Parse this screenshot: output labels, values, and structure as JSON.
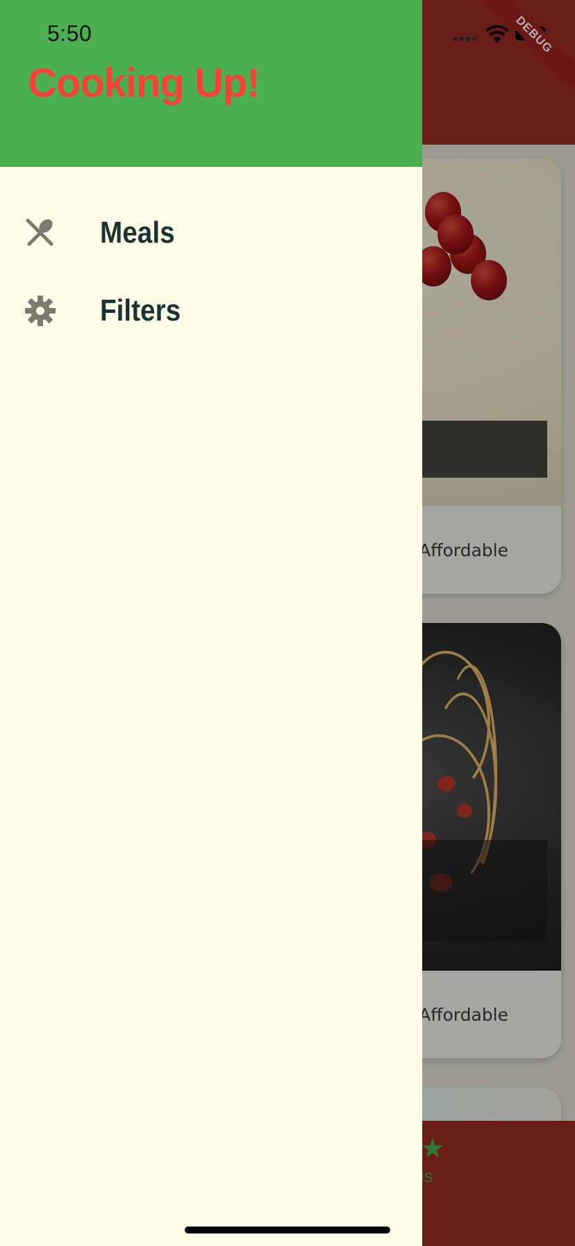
{
  "status_bar": {
    "time": "5:50"
  },
  "drawer": {
    "title": "Cooking Up!",
    "items": [
      {
        "label": "Meals",
        "icon": "restaurant-icon"
      },
      {
        "label": "Filters",
        "icon": "gear-icon"
      }
    ]
  },
  "background": {
    "cards": [
      {
        "meta": "Affordable"
      },
      {
        "meta": "Affordable"
      }
    ],
    "bottom_nav": {
      "partial_label": "orites"
    },
    "debug_banner": "DEBUG"
  },
  "colors": {
    "drawer_header": "#4caf50",
    "title": "#f44336",
    "drawer_bg": "#fffde8",
    "item_text": "#1a3233",
    "app_bar": "#9c2a22"
  }
}
